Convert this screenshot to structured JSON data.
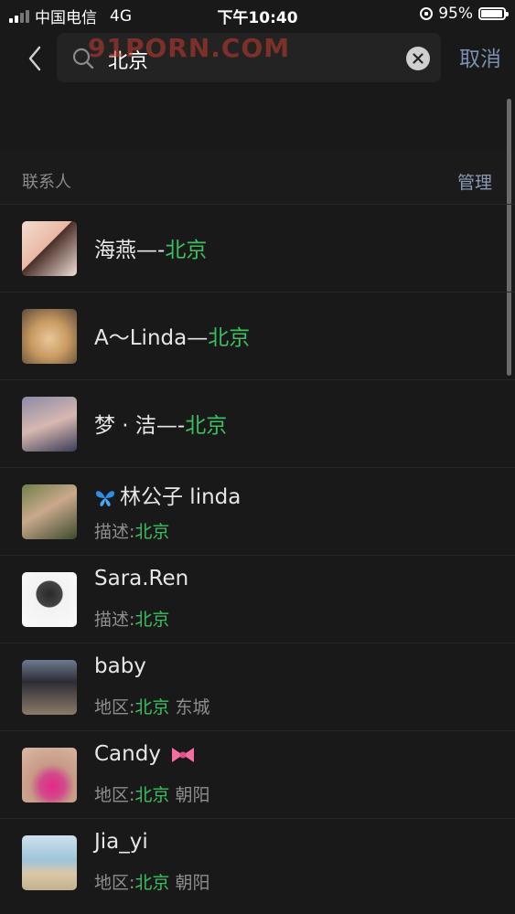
{
  "status": {
    "carrier": "中国电信",
    "network": "4G",
    "time": "下午10:40",
    "battery": "95%",
    "battery_level": 0.95
  },
  "search": {
    "query": "北京",
    "cancel_label": "取消"
  },
  "watermark": "91PORN.COM",
  "section": {
    "title": "联系人",
    "manage_label": "管理"
  },
  "contacts": [
    {
      "name_pre": "海燕—-",
      "name_hl": "北京"
    },
    {
      "name_pre": "A～Linda—",
      "name_hl": "北京"
    },
    {
      "name_pre": "梦 · 洁—-",
      "name_hl": "北京"
    },
    {
      "name": "林公子 linda",
      "emoji": "butterfly-icon",
      "sub_label": "描述:",
      "sub_hl": "北京",
      "sub_rest": ""
    },
    {
      "name": "Sara.Ren",
      "sub_label": "描述:",
      "sub_hl": "北京",
      "sub_rest": ""
    },
    {
      "name": "baby",
      "sub_label": "地区:",
      "sub_hl": "北京",
      "sub_rest": " 东城"
    },
    {
      "name": "Candy",
      "emoji": "ribbon-icon",
      "sub_label": "地区:",
      "sub_hl": "北京",
      "sub_rest": " 朝阳"
    },
    {
      "name": "Jia_yi",
      "sub_label": "地区:",
      "sub_hl": "北京",
      "sub_rest": " 朝阳"
    }
  ],
  "colors": {
    "highlight": "#3cbf60",
    "link": "#7a8fb0",
    "background": "#191919"
  }
}
